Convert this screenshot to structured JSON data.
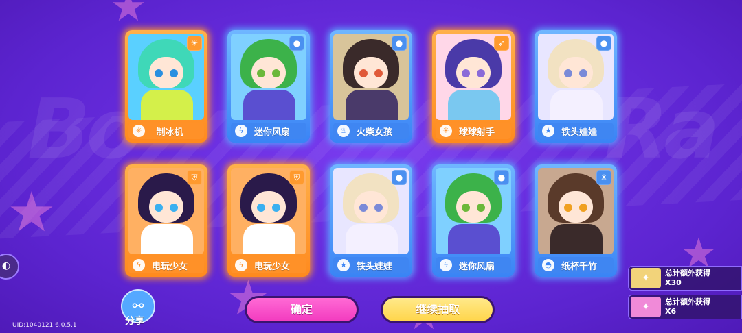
{
  "colors": {
    "background": "#6a2ee0",
    "orange_card": "#ff8a1e",
    "blue_card": "#3a84f5",
    "confirm_button": "#f23bbf",
    "continue_button": "#ffd54a"
  },
  "cards": [
    {
      "name": "制冰机",
      "rarity": "orange",
      "element_icon": "sun-icon",
      "type_icon": "snowflake-icon",
      "hair": "#3fd8b8",
      "eye": "#2a8fe0",
      "outfit": "#d4f04a",
      "bg": "#5ad0ff"
    },
    {
      "name": "迷你风扇",
      "rarity": "blue",
      "element_icon": "bomb-icon",
      "type_icon": "lightning-icon",
      "hair": "#3cb24a",
      "eye": "#6bb83a",
      "outfit": "#5a4fd0",
      "bg": "#7fd0ff"
    },
    {
      "name": "火柴女孩",
      "rarity": "blue",
      "element_icon": "bomb-icon",
      "type_icon": "flame-icon",
      "hair": "#3a2a2a",
      "eye": "#e05a3a",
      "outfit": "#4a3a6a",
      "bg": "#d8c49a"
    },
    {
      "name": "球球射手",
      "rarity": "orange",
      "element_icon": "bow-icon",
      "type_icon": "snowflake-icon",
      "hair": "#4a3aa8",
      "eye": "#8a6ad8",
      "outfit": "#7ac8f0",
      "bg": "#ffd7e8"
    },
    {
      "name": "铁头娃娃",
      "rarity": "blue",
      "element_icon": "bomb-icon",
      "type_icon": "star-icon",
      "hair": "#f2e2c2",
      "eye": "#7a8ad8",
      "outfit": "#f4f0ff",
      "bg": "#e8e6ff"
    },
    {
      "name": "电玩少女",
      "rarity": "orange",
      "element_icon": "shield-icon",
      "type_icon": "lightning-icon",
      "hair": "#2a1a4a",
      "eye": "#3ab0f0",
      "outfit": "#ffffff",
      "bg": "#ffb062"
    },
    {
      "name": "电玩少女",
      "rarity": "orange",
      "element_icon": "shield-icon",
      "type_icon": "lightning-icon",
      "hair": "#2a1a4a",
      "eye": "#3ab0f0",
      "outfit": "#ffffff",
      "bg": "#ffb062"
    },
    {
      "name": "铁头娃娃",
      "rarity": "blue",
      "element_icon": "bomb-icon",
      "type_icon": "star-icon",
      "hair": "#f2e2c2",
      "eye": "#7a8ad8",
      "outfit": "#f4f0ff",
      "bg": "#e8e6ff"
    },
    {
      "name": "迷你风扇",
      "rarity": "blue",
      "element_icon": "bomb-icon",
      "type_icon": "lightning-icon",
      "hair": "#3cb24a",
      "eye": "#6bb83a",
      "outfit": "#5a4fd0",
      "bg": "#7fd0ff"
    },
    {
      "name": "纸杯千竹",
      "rarity": "blue",
      "element_icon": "sun-icon",
      "type_icon": "cupcake-icon",
      "hair": "#5a3a2a",
      "eye": "#f0a020",
      "outfit": "#3a2a2a",
      "bg": "#c8a890"
    }
  ],
  "share": {
    "label": "分享",
    "icon": "share-icon"
  },
  "uid_text": "UID:1040121 6.0.5.1",
  "buttons": {
    "confirm": "确定",
    "continue": "继续抽取"
  },
  "rewards": [
    {
      "title": "总计额外获得",
      "count": "X30",
      "color": "#f2d37a"
    },
    {
      "title": "总计额外获得",
      "count": "X6",
      "color": "#f08ad8"
    }
  ]
}
